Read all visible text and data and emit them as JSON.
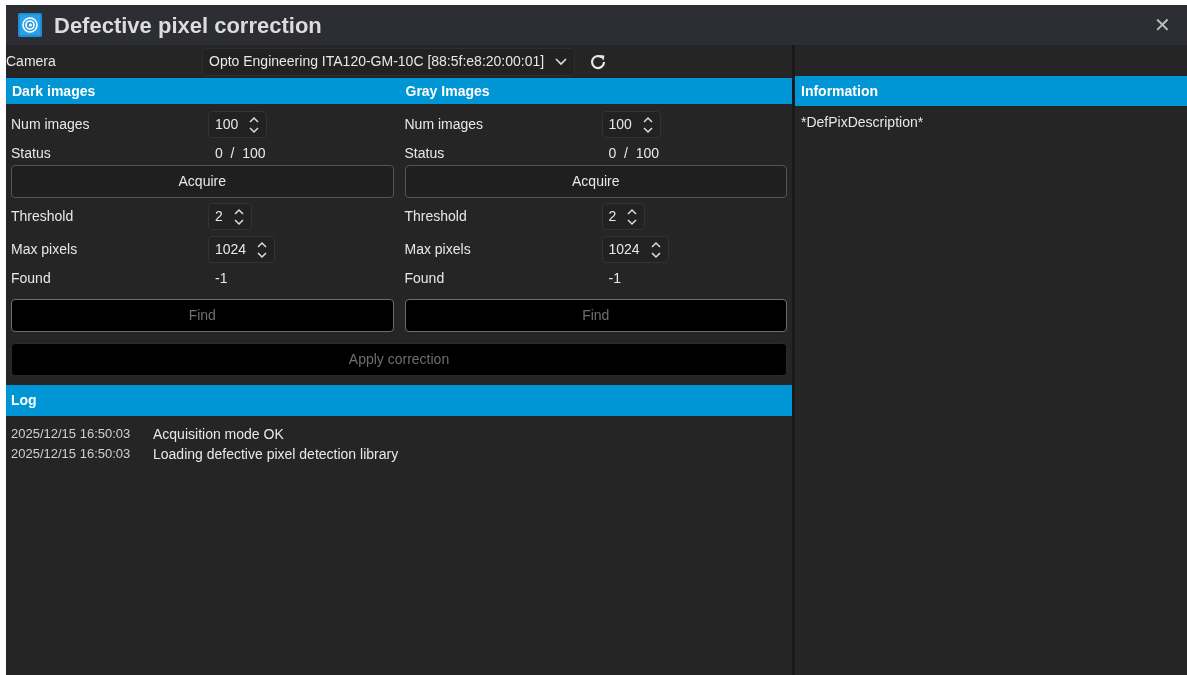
{
  "window": {
    "title": "Defective pixel correction",
    "close": "✕"
  },
  "camera": {
    "label": "Camera",
    "value": "Opto Engineering ITA120-GM-10C [88:5f:e8:20:00:01]"
  },
  "groups": [
    {
      "title": "Dark images",
      "num_images": {
        "label": "Num images",
        "value": "100"
      },
      "status": {
        "label": "Status",
        "value": "0  /  100"
      },
      "acquire": {
        "label": "Acquire",
        "disabled": false
      },
      "threshold": {
        "label": "Threshold",
        "value": "2"
      },
      "max_pixels": {
        "label": "Max pixels",
        "value": "1024"
      },
      "found": {
        "label": "Found",
        "value": "-1"
      },
      "find": {
        "label": "Find",
        "disabled": true
      }
    },
    {
      "title": "Gray Images",
      "num_images": {
        "label": "Num images",
        "value": "100"
      },
      "status": {
        "label": "Status",
        "value": "0  /  100"
      },
      "acquire": {
        "label": "Acquire",
        "disabled": false
      },
      "threshold": {
        "label": "Threshold",
        "value": "2"
      },
      "max_pixels": {
        "label": "Max pixels",
        "value": "1024"
      },
      "found": {
        "label": "Found",
        "value": "-1"
      },
      "find": {
        "label": "Find",
        "disabled": true
      }
    }
  ],
  "apply": {
    "label": "Apply correction",
    "disabled": true
  },
  "log": {
    "title": "Log",
    "entries": [
      {
        "time": "2025/12/15 16:50:03",
        "message": "Acquisition mode OK"
      },
      {
        "time": "2025/12/15 16:50:03",
        "message": "Loading defective pixel detection library"
      }
    ]
  },
  "information": {
    "title": "Information",
    "text": "*DefPixDescription*"
  }
}
